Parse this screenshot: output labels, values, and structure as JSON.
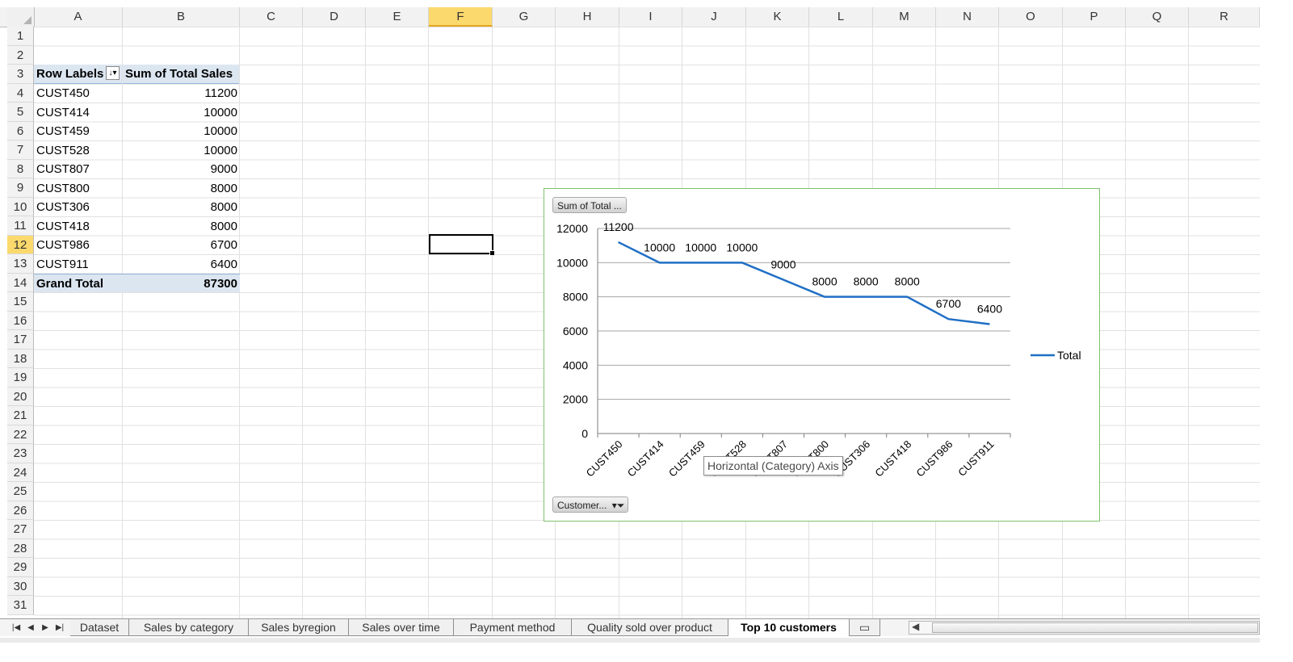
{
  "columns": [
    "A",
    "B",
    "C",
    "D",
    "E",
    "F",
    "G",
    "H",
    "I",
    "J",
    "K",
    "L",
    "M",
    "N",
    "O",
    "P",
    "Q",
    "R"
  ],
  "rows": [
    "1",
    "2",
    "3",
    "4",
    "5",
    "6",
    "7",
    "8",
    "9",
    "10",
    "11",
    "12",
    "13",
    "14",
    "15",
    "16",
    "17",
    "18",
    "19",
    "20",
    "21",
    "22",
    "23",
    "24",
    "25",
    "26",
    "27",
    "28",
    "29",
    "30",
    "31"
  ],
  "active_column": "F",
  "active_row": "12",
  "pivot": {
    "header_label": "Row Labels",
    "header_value": "Sum of Total Sales",
    "filter_icon": "sort-filter-icon",
    "rows": [
      {
        "label": "CUST450",
        "value": "11200"
      },
      {
        "label": "CUST414",
        "value": "10000"
      },
      {
        "label": "CUST459",
        "value": "10000"
      },
      {
        "label": "CUST528",
        "value": "10000"
      },
      {
        "label": "CUST807",
        "value": "9000"
      },
      {
        "label": "CUST800",
        "value": "8000"
      },
      {
        "label": "CUST306",
        "value": "8000"
      },
      {
        "label": "CUST418",
        "value": "8000"
      },
      {
        "label": "CUST986",
        "value": "6700"
      },
      {
        "label": "CUST911",
        "value": "6400"
      }
    ],
    "total_label": "Grand Total",
    "total_value": "87300"
  },
  "chart": {
    "value_field_button": "Sum of Total ...",
    "axis_field_button": "Customer...",
    "tooltip": "Horizontal (Category) Axis",
    "colors": {
      "series": "#1f6fc5",
      "border": "#7ec26a",
      "gridline": "#a6a6a6"
    }
  },
  "chart_data": {
    "type": "line",
    "categories": [
      "CUST450",
      "CUST414",
      "CUST459",
      "CUST528",
      "CUST807",
      "CUST800",
      "CUST306",
      "CUST418",
      "CUST986",
      "CUST911"
    ],
    "series": [
      {
        "name": "Total",
        "values": [
          11200,
          10000,
          10000,
          10000,
          9000,
          8000,
          8000,
          8000,
          6700,
          6400
        ]
      }
    ],
    "data_labels": [
      "11200",
      "10000",
      "10000",
      "10000",
      "9000",
      "8000",
      "8000",
      "8000",
      "6700",
      "6400"
    ],
    "yticks": [
      "0",
      "2000",
      "4000",
      "6000",
      "8000",
      "10000",
      "12000"
    ],
    "ylim": [
      0,
      12000
    ],
    "grid": true,
    "legend": "right"
  },
  "tabs": [
    {
      "label": "Dataset",
      "active": false
    },
    {
      "label": "Sales  by category",
      "active": false
    },
    {
      "label": "Sales byregion",
      "active": false
    },
    {
      "label": "Sales over time",
      "active": false
    },
    {
      "label": "Payment method",
      "active": false
    },
    {
      "label": "Quality sold over product",
      "active": false
    },
    {
      "label": "Top 10 customers",
      "active": true
    }
  ],
  "nav_icons": [
    "first-sheet-icon",
    "prev-sheet-icon",
    "next-sheet-icon",
    "last-sheet-icon"
  ],
  "insert_sheet_icon": "insert-sheet-icon"
}
